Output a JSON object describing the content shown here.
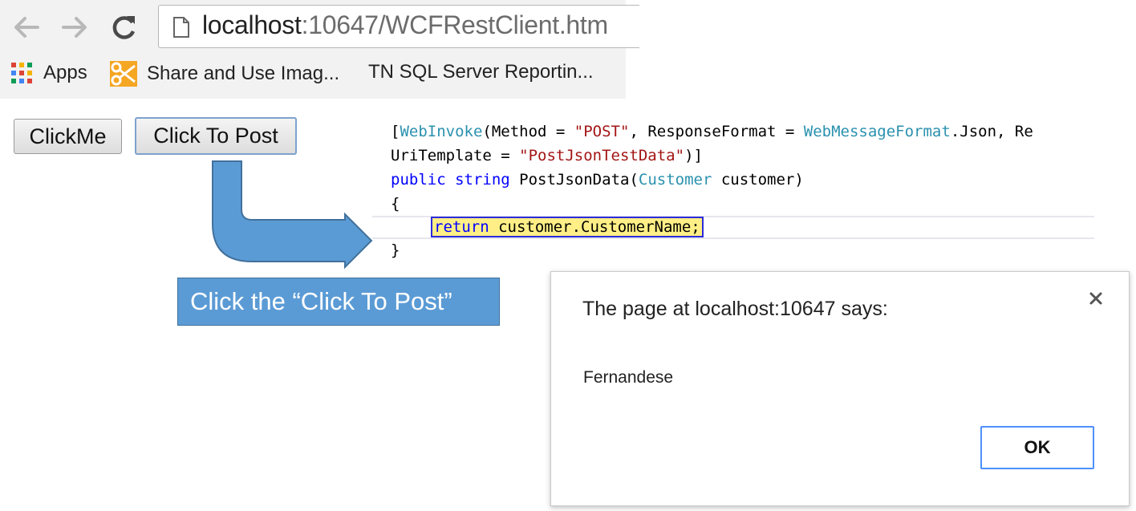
{
  "browser": {
    "url_host": "localhost",
    "url_rest": ":10647/WCFRestClient.htm",
    "bookmarks": [
      {
        "label": "Apps"
      },
      {
        "label": "Share and Use Imag..."
      },
      {
        "label": "TN SQL Server Reportin..."
      }
    ]
  },
  "page": {
    "clickme_label": "ClickMe",
    "post_label": "Click To Post"
  },
  "code": {
    "l1_bracket": "[",
    "l1_attr": "WebInvoke",
    "l1_method": "(Method = ",
    "l1_post": "\"POST\"",
    "l1_resp": ", ResponseFormat = ",
    "l1_wmf": "WebMessageFormat",
    "l1_json": ".Json, Re",
    "l2_uri": "UriTemplate = ",
    "l2_str": "\"PostJsonTestData\"",
    "l2_end": ")]",
    "l3_public": "public",
    "l3_string": "string",
    "l3_method": " PostJsonData(",
    "l3_type": "Customer",
    "l3_param": " customer)",
    "l4_open": "{",
    "l5_return": "return",
    "l5_rest": " customer.CustomerName;",
    "l6_close": "}"
  },
  "callout": {
    "text": "Click the “Click To Post”"
  },
  "dialog": {
    "title": "The page at localhost:10647 says:",
    "message": "Fernandese",
    "ok_label": "OK"
  },
  "colors": {
    "callout_fill": "#5b9bd5",
    "arrow_fill": "#5b9bd5",
    "keyword": "#0000ff",
    "type": "#2b91af",
    "string": "#a31515",
    "highlight": "#ffef86",
    "ok_border": "#4d90fe"
  }
}
